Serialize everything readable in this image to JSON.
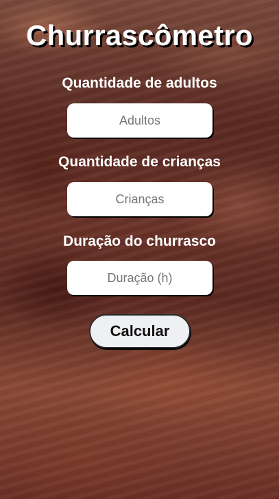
{
  "app": {
    "title": "Churrascômetro"
  },
  "form": {
    "adults": {
      "label": "Quantidade de adultos",
      "placeholder": "Adultos",
      "value": ""
    },
    "children": {
      "label": "Quantidade de crianças",
      "placeholder": "Crianças",
      "value": ""
    },
    "duration": {
      "label": "Duração do churrasco",
      "placeholder": "Duração (h)",
      "value": ""
    },
    "submit_label": "Calcular"
  },
  "colors": {
    "title_text": "#ffffff",
    "label_text": "#ffffff",
    "input_bg": "#ffffff",
    "button_bg": "#eef0f3",
    "background_tone": "#6a3328"
  }
}
